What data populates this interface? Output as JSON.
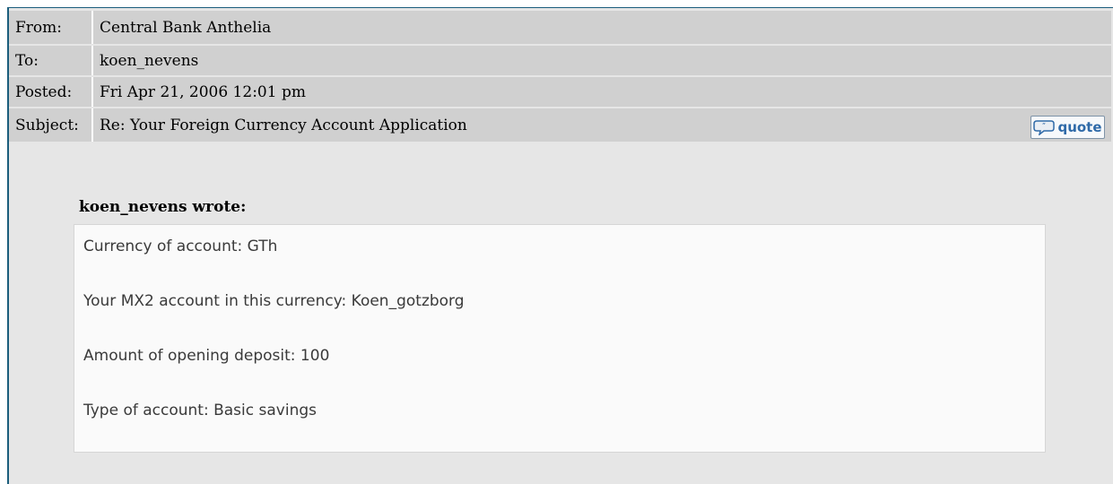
{
  "header": {
    "from_label": "From:",
    "from_value": "Central Bank Anthelia",
    "to_label": "To:",
    "to_value": "koen_nevens",
    "posted_label": "Posted:",
    "posted_value": "Fri Apr 21, 2006 12:01 pm",
    "subject_label": "Subject:",
    "subject_value": "Re: Your Foreign Currency Account Application",
    "quote_button": {
      "label": "quote",
      "icon": "speech-bubble-icon"
    }
  },
  "message": {
    "quote_author": "koen_nevens wrote:",
    "quote_lines": [
      "Currency of account: GTh",
      "Your MX2 account in this currency: Koen_gotzborg",
      "Amount of opening deposit: 100",
      "Type of account: Basic savings"
    ]
  },
  "colors": {
    "header_row_bg": "#d0d0d0",
    "body_bg": "#e6e6e6",
    "frame_border": "#1b5d7c",
    "quote_box_bg": "#fafafa",
    "quote_button_text": "#2f6aa8"
  }
}
